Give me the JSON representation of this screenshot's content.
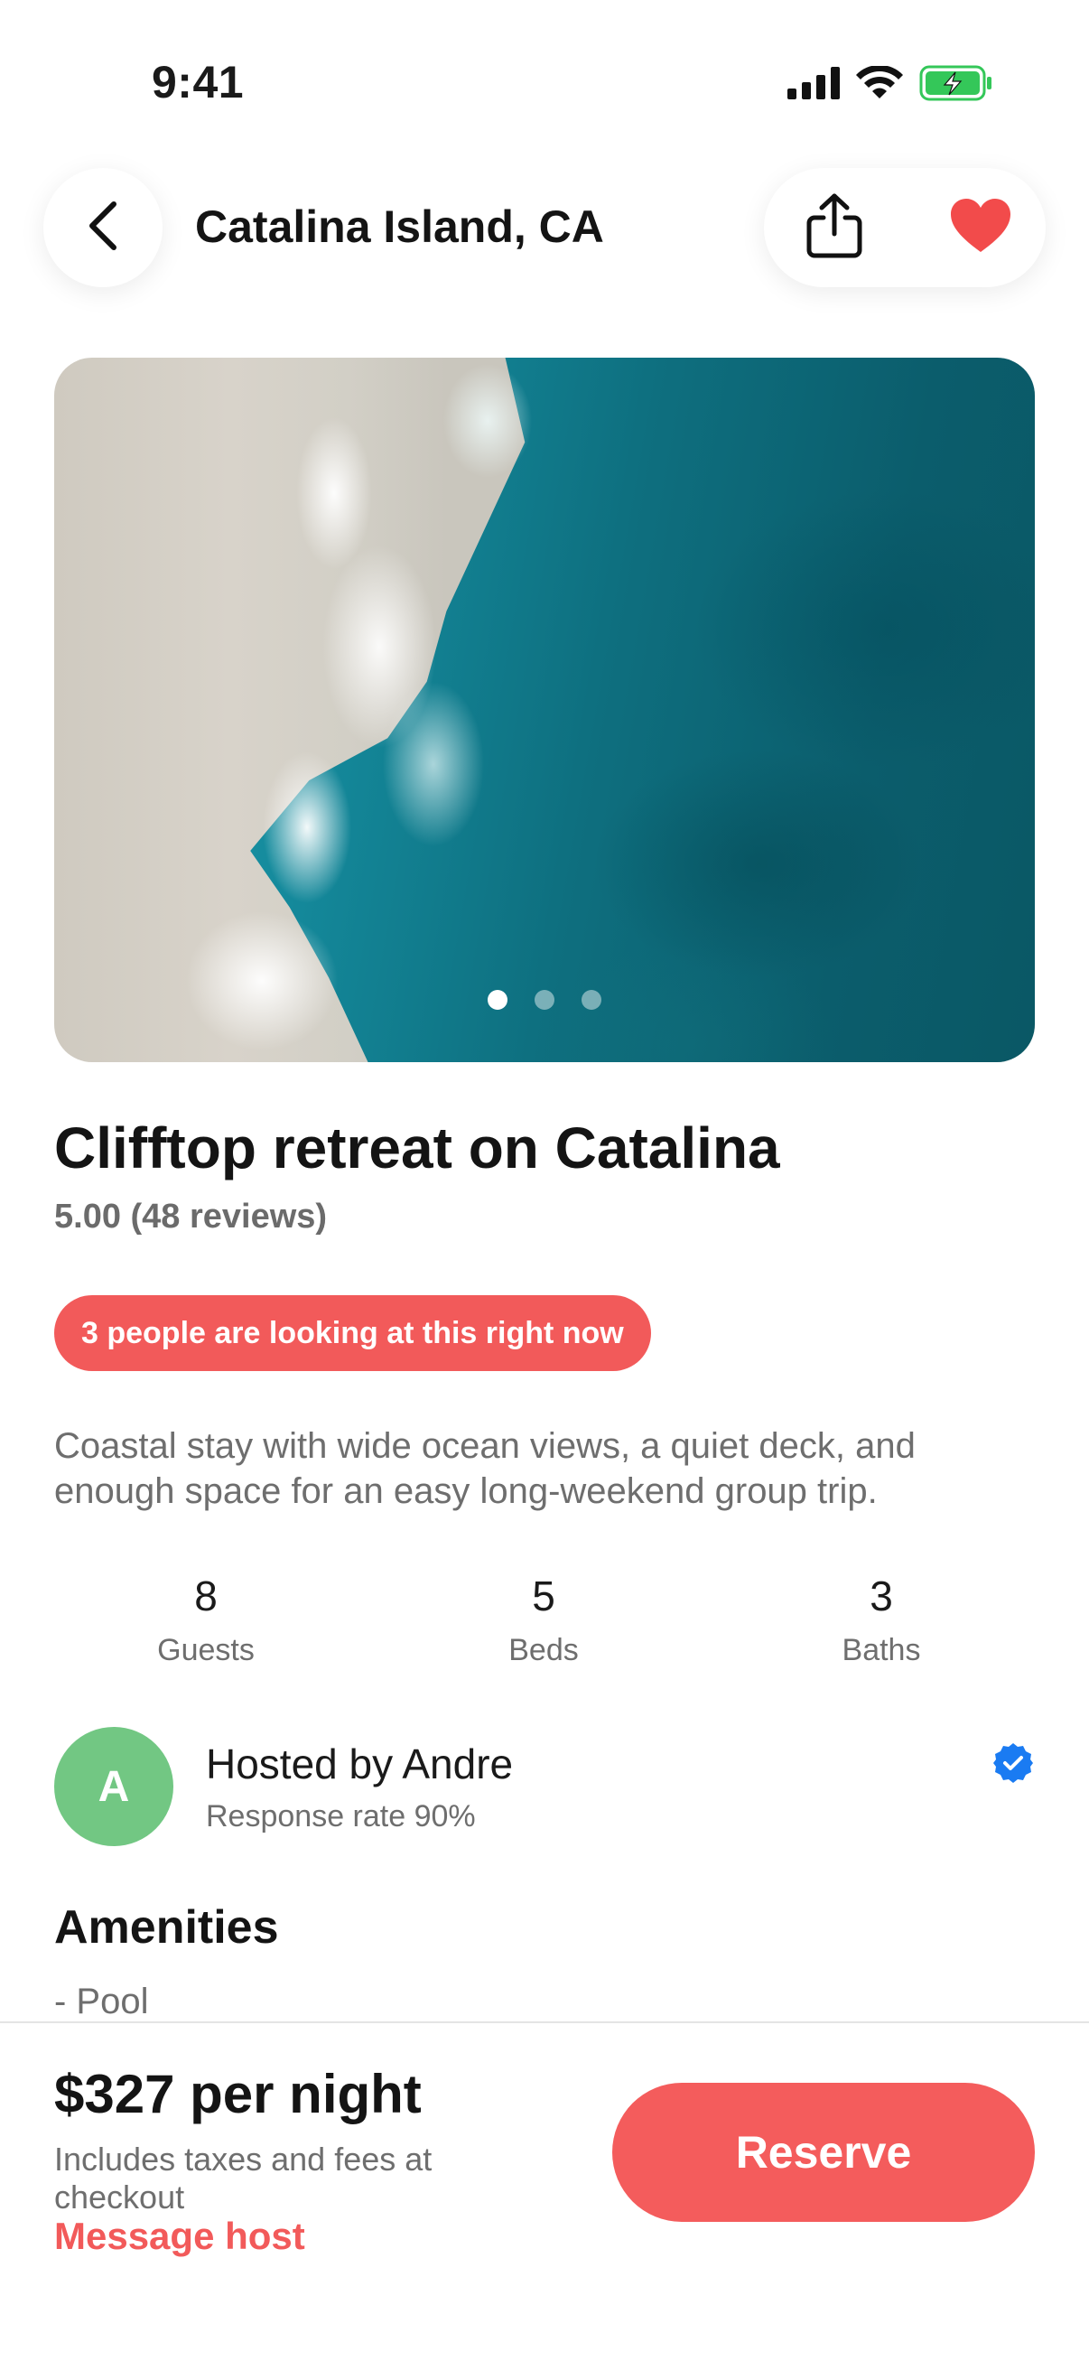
{
  "status_bar": {
    "time": "9:41"
  },
  "header": {
    "title": "Catalina Island, CA"
  },
  "hero": {
    "image_alt": "Aerial ocean shoreline",
    "page_count": 3,
    "active_index": 0
  },
  "listing": {
    "title": "Clifftop retreat on Catalina",
    "rating": "5.00 (48 reviews)",
    "alert": "3 people are looking at this right now",
    "description": "Coastal stay with wide ocean views, a quiet deck, and enough space for an easy long-weekend group trip."
  },
  "stats": [
    {
      "value": "8",
      "label": "Guests"
    },
    {
      "value": "5",
      "label": "Beds"
    },
    {
      "value": "3",
      "label": "Baths"
    }
  ],
  "host": {
    "initial": "A",
    "name": "Hosted by Andre",
    "response": "Response rate 90%",
    "avatar_color": "#72c783"
  },
  "amenities": {
    "title": "Amenities",
    "items": [
      "- Pool"
    ]
  },
  "booking": {
    "price": "$327 per night",
    "fees": "Includes taxes and fees at checkout",
    "message_host": "Message host",
    "reserve": "Reserve"
  },
  "colors": {
    "accent": "#f25a5a",
    "verified": "#1a7bf2"
  },
  "icons": [
    "back-chevron-icon",
    "share-icon",
    "heart-icon",
    "verified-badge-icon",
    "signal-icon",
    "wifi-icon",
    "battery-icon"
  ]
}
